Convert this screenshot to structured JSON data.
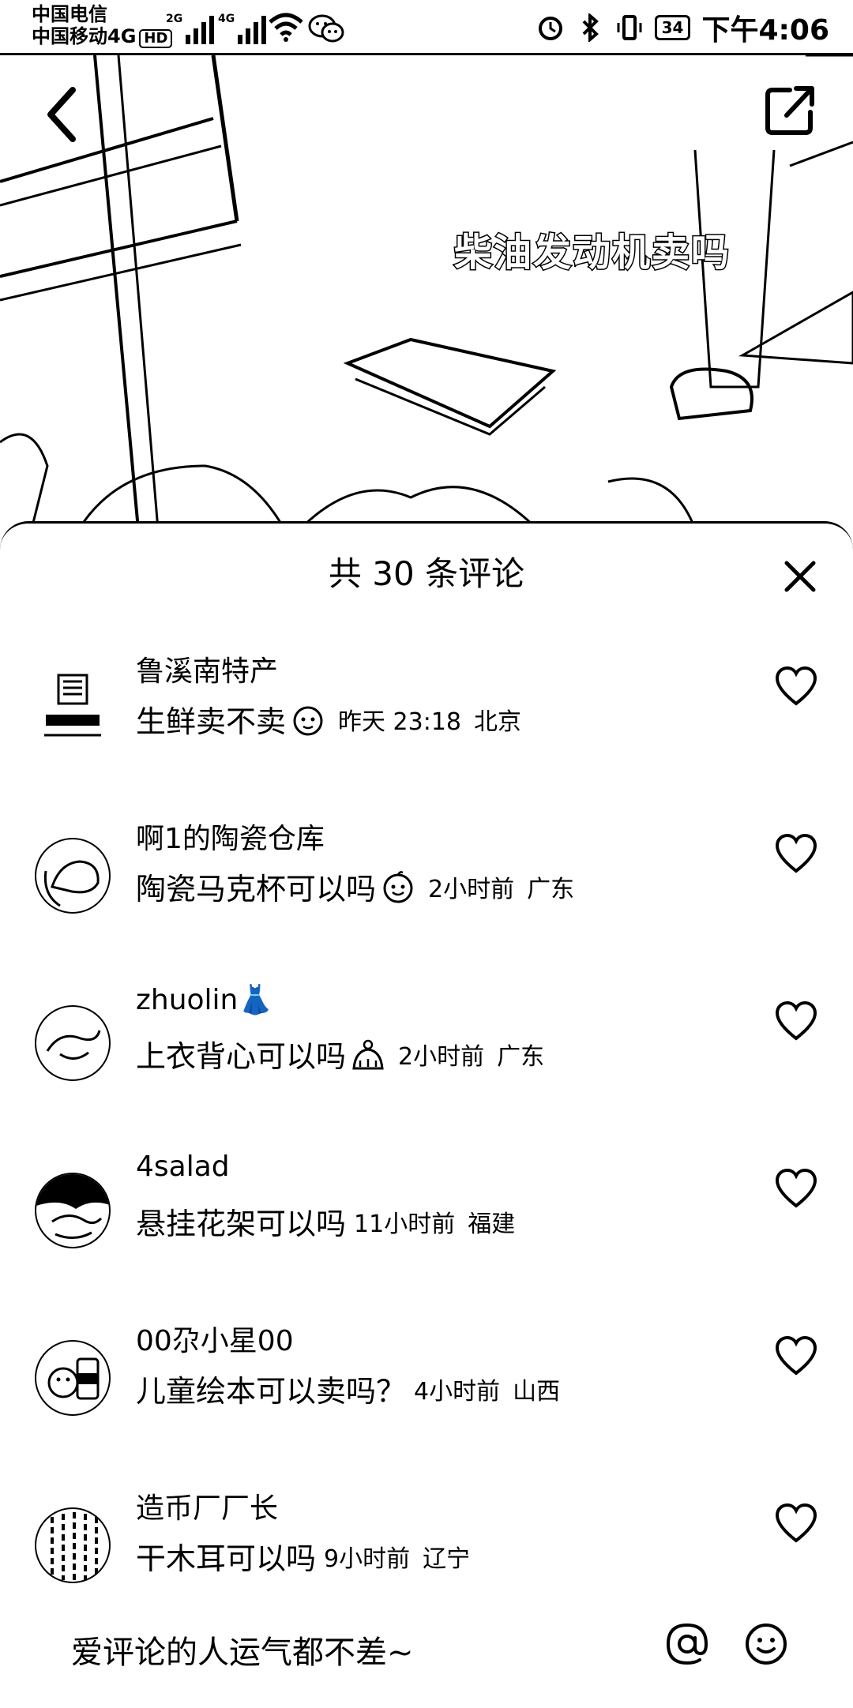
{
  "status_bar": {
    "carrier1": "中国电信",
    "carrier2": "中国移动4G",
    "hd": "HD",
    "net1": "2G",
    "net2": "4G",
    "battery": "34",
    "time": "下午4:06"
  },
  "video": {
    "caption": "柴油发动机卖吗"
  },
  "comments_sheet": {
    "title": "共 30 条评论",
    "comments": [
      {
        "user": "鲁溪南特产",
        "text": "生鲜卖不卖",
        "has_emoji": true,
        "time": "昨天 23:18",
        "location": "北京"
      },
      {
        "user": "啊1的陶瓷仓库",
        "text": "陶瓷马克杯可以吗",
        "has_emoji": true,
        "time": "2小时前",
        "location": "广东"
      },
      {
        "user": "zhuolin👗",
        "text": "上衣背心可以吗",
        "has_emoji": true,
        "time": "2小时前",
        "location": "广东"
      },
      {
        "user": "4salad",
        "text": "悬挂花架可以吗",
        "has_emoji": false,
        "time": "11小时前",
        "location": "福建"
      },
      {
        "user": "00尕小星00",
        "text": "儿童绘本可以卖吗？",
        "has_emoji": false,
        "time": "4小时前",
        "location": "山西"
      },
      {
        "user": "造币厂厂长",
        "text": "干木耳可以吗",
        "has_emoji": false,
        "time": "9小时前",
        "location": "辽宁"
      }
    ]
  },
  "input": {
    "placeholder": "爱评论的人运气都不差~"
  }
}
